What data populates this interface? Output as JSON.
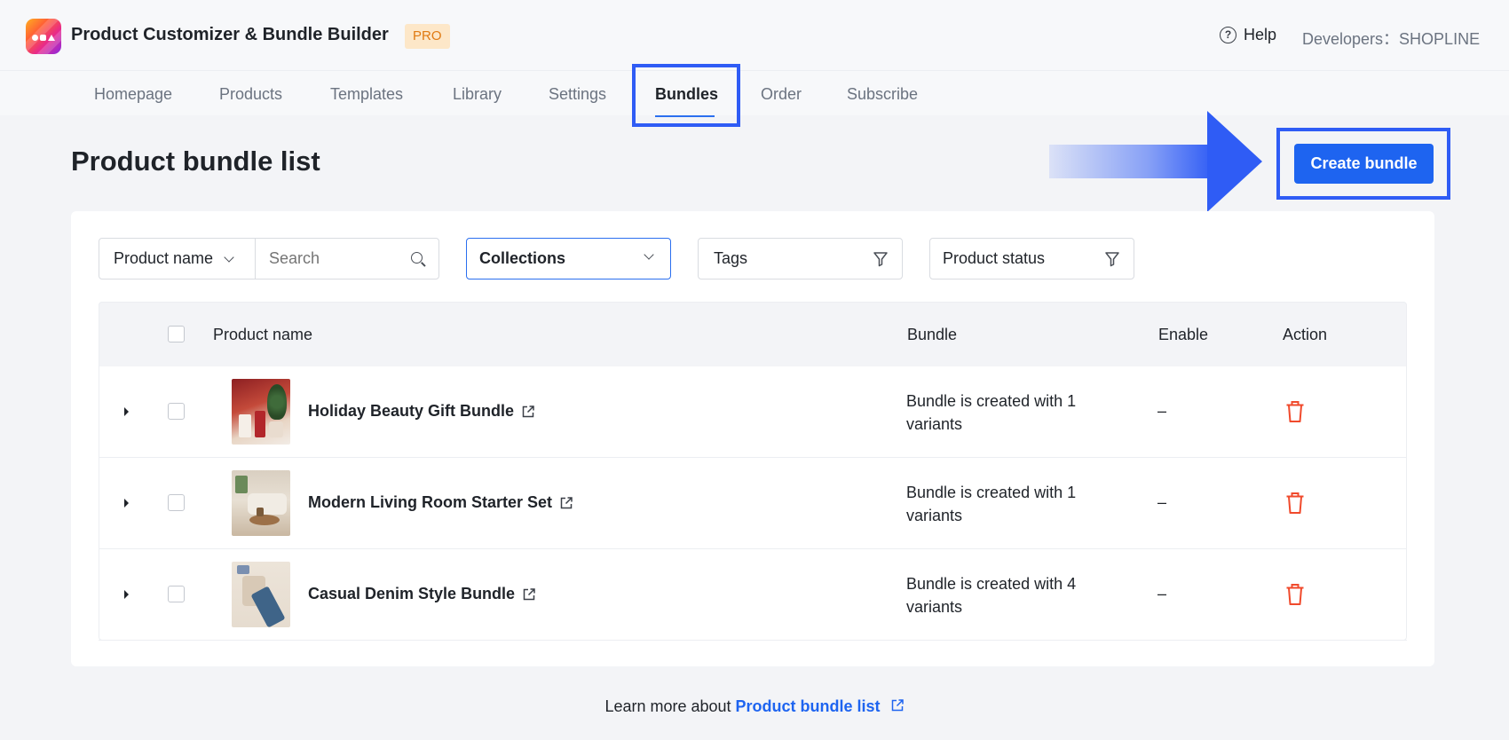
{
  "app": {
    "title": "Product Customizer & Bundle Builder",
    "badge": "PRO",
    "help_label": "Help",
    "developers_label": "Developers：SHOPLINE"
  },
  "nav": {
    "tabs": [
      {
        "label": "Homepage"
      },
      {
        "label": "Products"
      },
      {
        "label": "Templates"
      },
      {
        "label": "Library"
      },
      {
        "label": "Settings"
      },
      {
        "label": "Bundles",
        "active": true
      },
      {
        "label": "Order"
      },
      {
        "label": "Subscribe"
      }
    ]
  },
  "page": {
    "title": "Product bundle list",
    "create_button": "Create bundle"
  },
  "filters": {
    "field_select": "Product name",
    "search_placeholder": "Search",
    "collections": "Collections",
    "tags": "Tags",
    "status": "Product status"
  },
  "table": {
    "headers": {
      "product_name": "Product name",
      "bundle": "Bundle",
      "enable": "Enable",
      "action": "Action"
    },
    "rows": [
      {
        "name": "Holiday Beauty Gift Bundle",
        "bundle": "Bundle is created with 1 variants",
        "enable": "–"
      },
      {
        "name": "Modern Living Room Starter Set",
        "bundle": "Bundle is created with 1 variants",
        "enable": "–"
      },
      {
        "name": "Casual Denim Style Bundle",
        "bundle": "Bundle is created with 4 variants",
        "enable": "–"
      }
    ]
  },
  "footer": {
    "text": "Learn more about ",
    "link": "Product bundle list"
  },
  "colors": {
    "accent": "#1e64f0",
    "highlight": "#2f5cf5",
    "danger": "#f04a2c",
    "badge_bg": "#fde7c8",
    "badge_text": "#e07a12"
  }
}
